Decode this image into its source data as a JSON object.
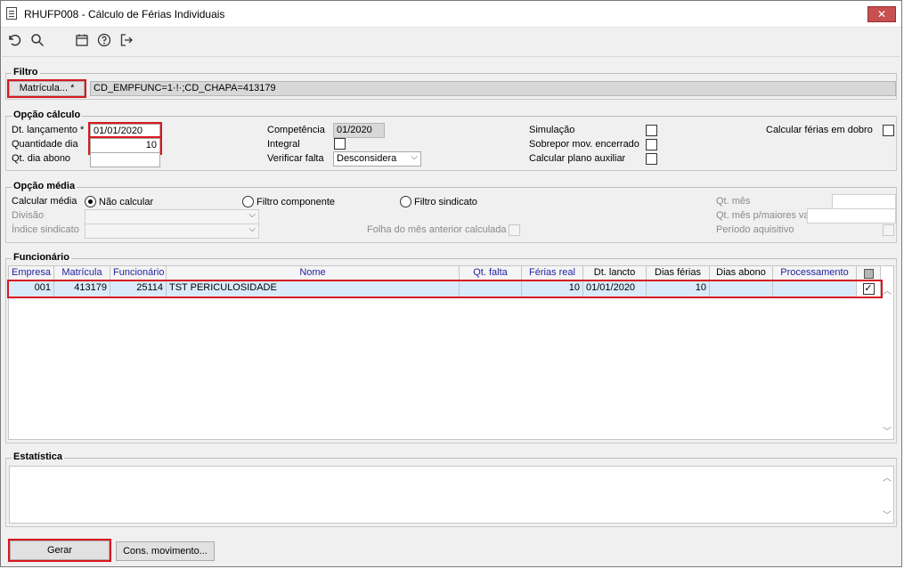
{
  "window": {
    "title": "RHUFP008 - Cálculo de Férias Individuais",
    "close_label": "✕"
  },
  "toolbar": {
    "icons": [
      "undo-icon",
      "search-icon",
      "calendar-icon",
      "help-icon",
      "exit-icon"
    ]
  },
  "filtro": {
    "group_label": "Filtro",
    "matricula_button": "Matrícula... *",
    "expression": "CD_EMPFUNC=1·!·;CD_CHAPA=413179"
  },
  "opcao_calculo": {
    "group_label": "Opção cálculo",
    "dt_lancamento_label": "Dt. lançamento *",
    "dt_lancamento_value": "01/01/2020",
    "quantidade_dia_label": "Quantidade dia",
    "quantidade_dia_value": "10",
    "qt_dia_abono_label": "Qt. dia abono",
    "qt_dia_abono_value": "",
    "competencia_label": "Competência",
    "competencia_value": "01/2020",
    "integral_label": "Integral",
    "verificar_falta_label": "Verificar falta",
    "verificar_falta_value": "Desconsidera",
    "simulacao_label": "Simulação",
    "sobrepor_label": "Sobrepor mov. encerrado",
    "plano_auxiliar_label": "Calcular plano auxiliar",
    "ferias_dobro_label": "Calcular férias em dobro"
  },
  "opcao_media": {
    "group_label": "Opção média",
    "calcular_media_label": "Calcular média",
    "radio_nao_calcular": "Não calcular",
    "radio_filtro_componente": "Filtro componente",
    "radio_filtro_sindicato": "Filtro sindicato",
    "divisao_label": "Divisão",
    "indice_sindicato_label": "Índice sindicato",
    "folha_mes_anterior_label": "Folha do mês anterior calculada",
    "qt_mes_label": "Qt. mês",
    "qt_mes_maiores_label": "Qt. mês p/maiores valores",
    "periodo_aquisitivo_label": "Período aquisitivo"
  },
  "funcionario": {
    "group_label": "Funcionário",
    "columns": [
      "Empresa",
      "Matrícula",
      "Funcionário",
      "Nome",
      "Qt. falta",
      "Férias real",
      "Dt. lancto",
      "Dias férias",
      "Dias abono",
      "Processamento"
    ],
    "rows": [
      {
        "empresa": "001",
        "matricula": "413179",
        "funcionario": "25114",
        "nome": "TST PERICULOSIDADE",
        "qt_falta": "",
        "ferias_real": "10",
        "dt_lancto": "01/01/2020",
        "dias_ferias": "10",
        "dias_abono": "",
        "processamento": "",
        "checked": "✓"
      }
    ]
  },
  "estatistica": {
    "group_label": "Estatística"
  },
  "buttons": {
    "gerar": "Gerar",
    "cons_movimento": "Cons. movimento..."
  },
  "colors": {
    "highlight_red": "#d9171f",
    "row_selected": "#d9ebfa",
    "header_blue_text": "#1f1f9e"
  }
}
